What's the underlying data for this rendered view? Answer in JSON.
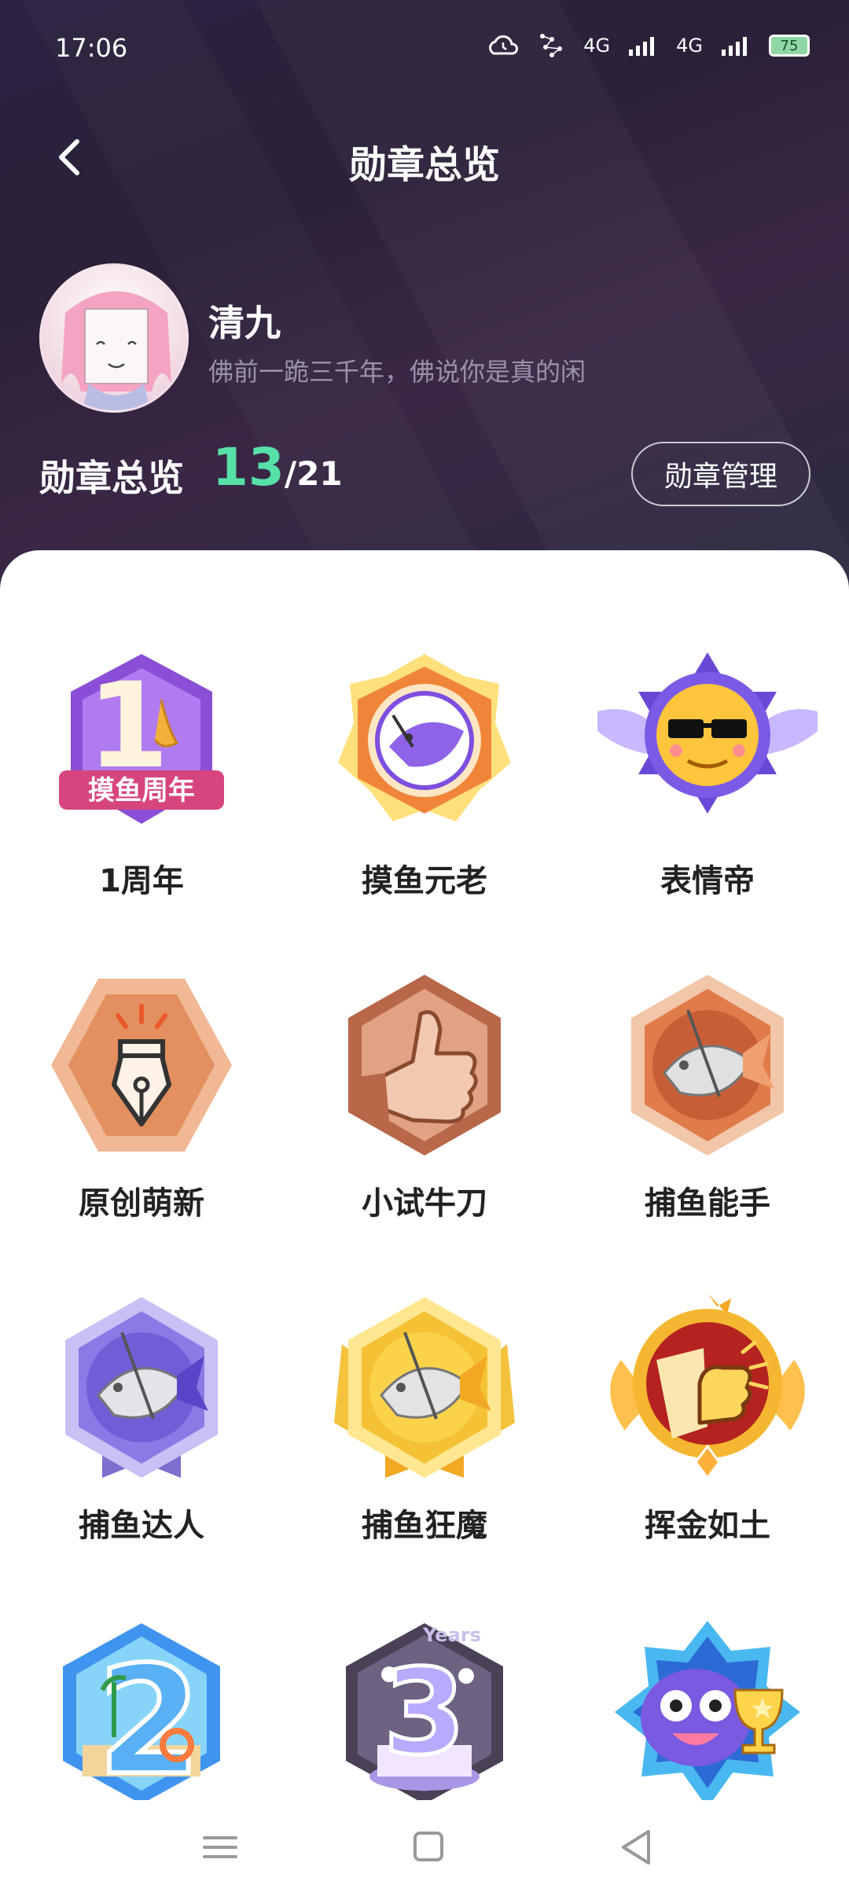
{
  "status_bar": {
    "time": "17:06",
    "network_1": "4G",
    "network_2": "4G",
    "battery": "75",
    "icons": [
      "cloud-icon",
      "signal-dots-icon",
      "signal-4g-icon",
      "signal-4g-icon",
      "battery-icon"
    ]
  },
  "header": {
    "title": "勋章总览",
    "back_icon": "chevron-left-icon"
  },
  "profile": {
    "name": "清九",
    "bio": "佛前一跪三千年，佛说你是真的闲"
  },
  "summary": {
    "label": "勋章总览",
    "earned": "13",
    "total": "/21",
    "manage_button": "勋章管理"
  },
  "badges": [
    {
      "label": "1周年",
      "badge_text": "摸鱼周年",
      "number": "1"
    },
    {
      "label": "摸鱼元老"
    },
    {
      "label": "表情帝"
    },
    {
      "label": "原创萌新"
    },
    {
      "label": "小试牛刀"
    },
    {
      "label": "捕鱼能手"
    },
    {
      "label": "捕鱼达人"
    },
    {
      "label": "捕鱼狂魔"
    },
    {
      "label": "挥金如土"
    },
    {
      "label": "",
      "number": "2"
    },
    {
      "label": "",
      "number": "3",
      "badge_text": "Years"
    },
    {
      "label": ""
    }
  ],
  "bottom_nav": [
    "menu-icon",
    "home-square-icon",
    "back-triangle-icon"
  ],
  "colors": {
    "accent_green": "#57e0a7",
    "header_bg": "#2a2240",
    "sheet_bg": "#ffffff"
  }
}
